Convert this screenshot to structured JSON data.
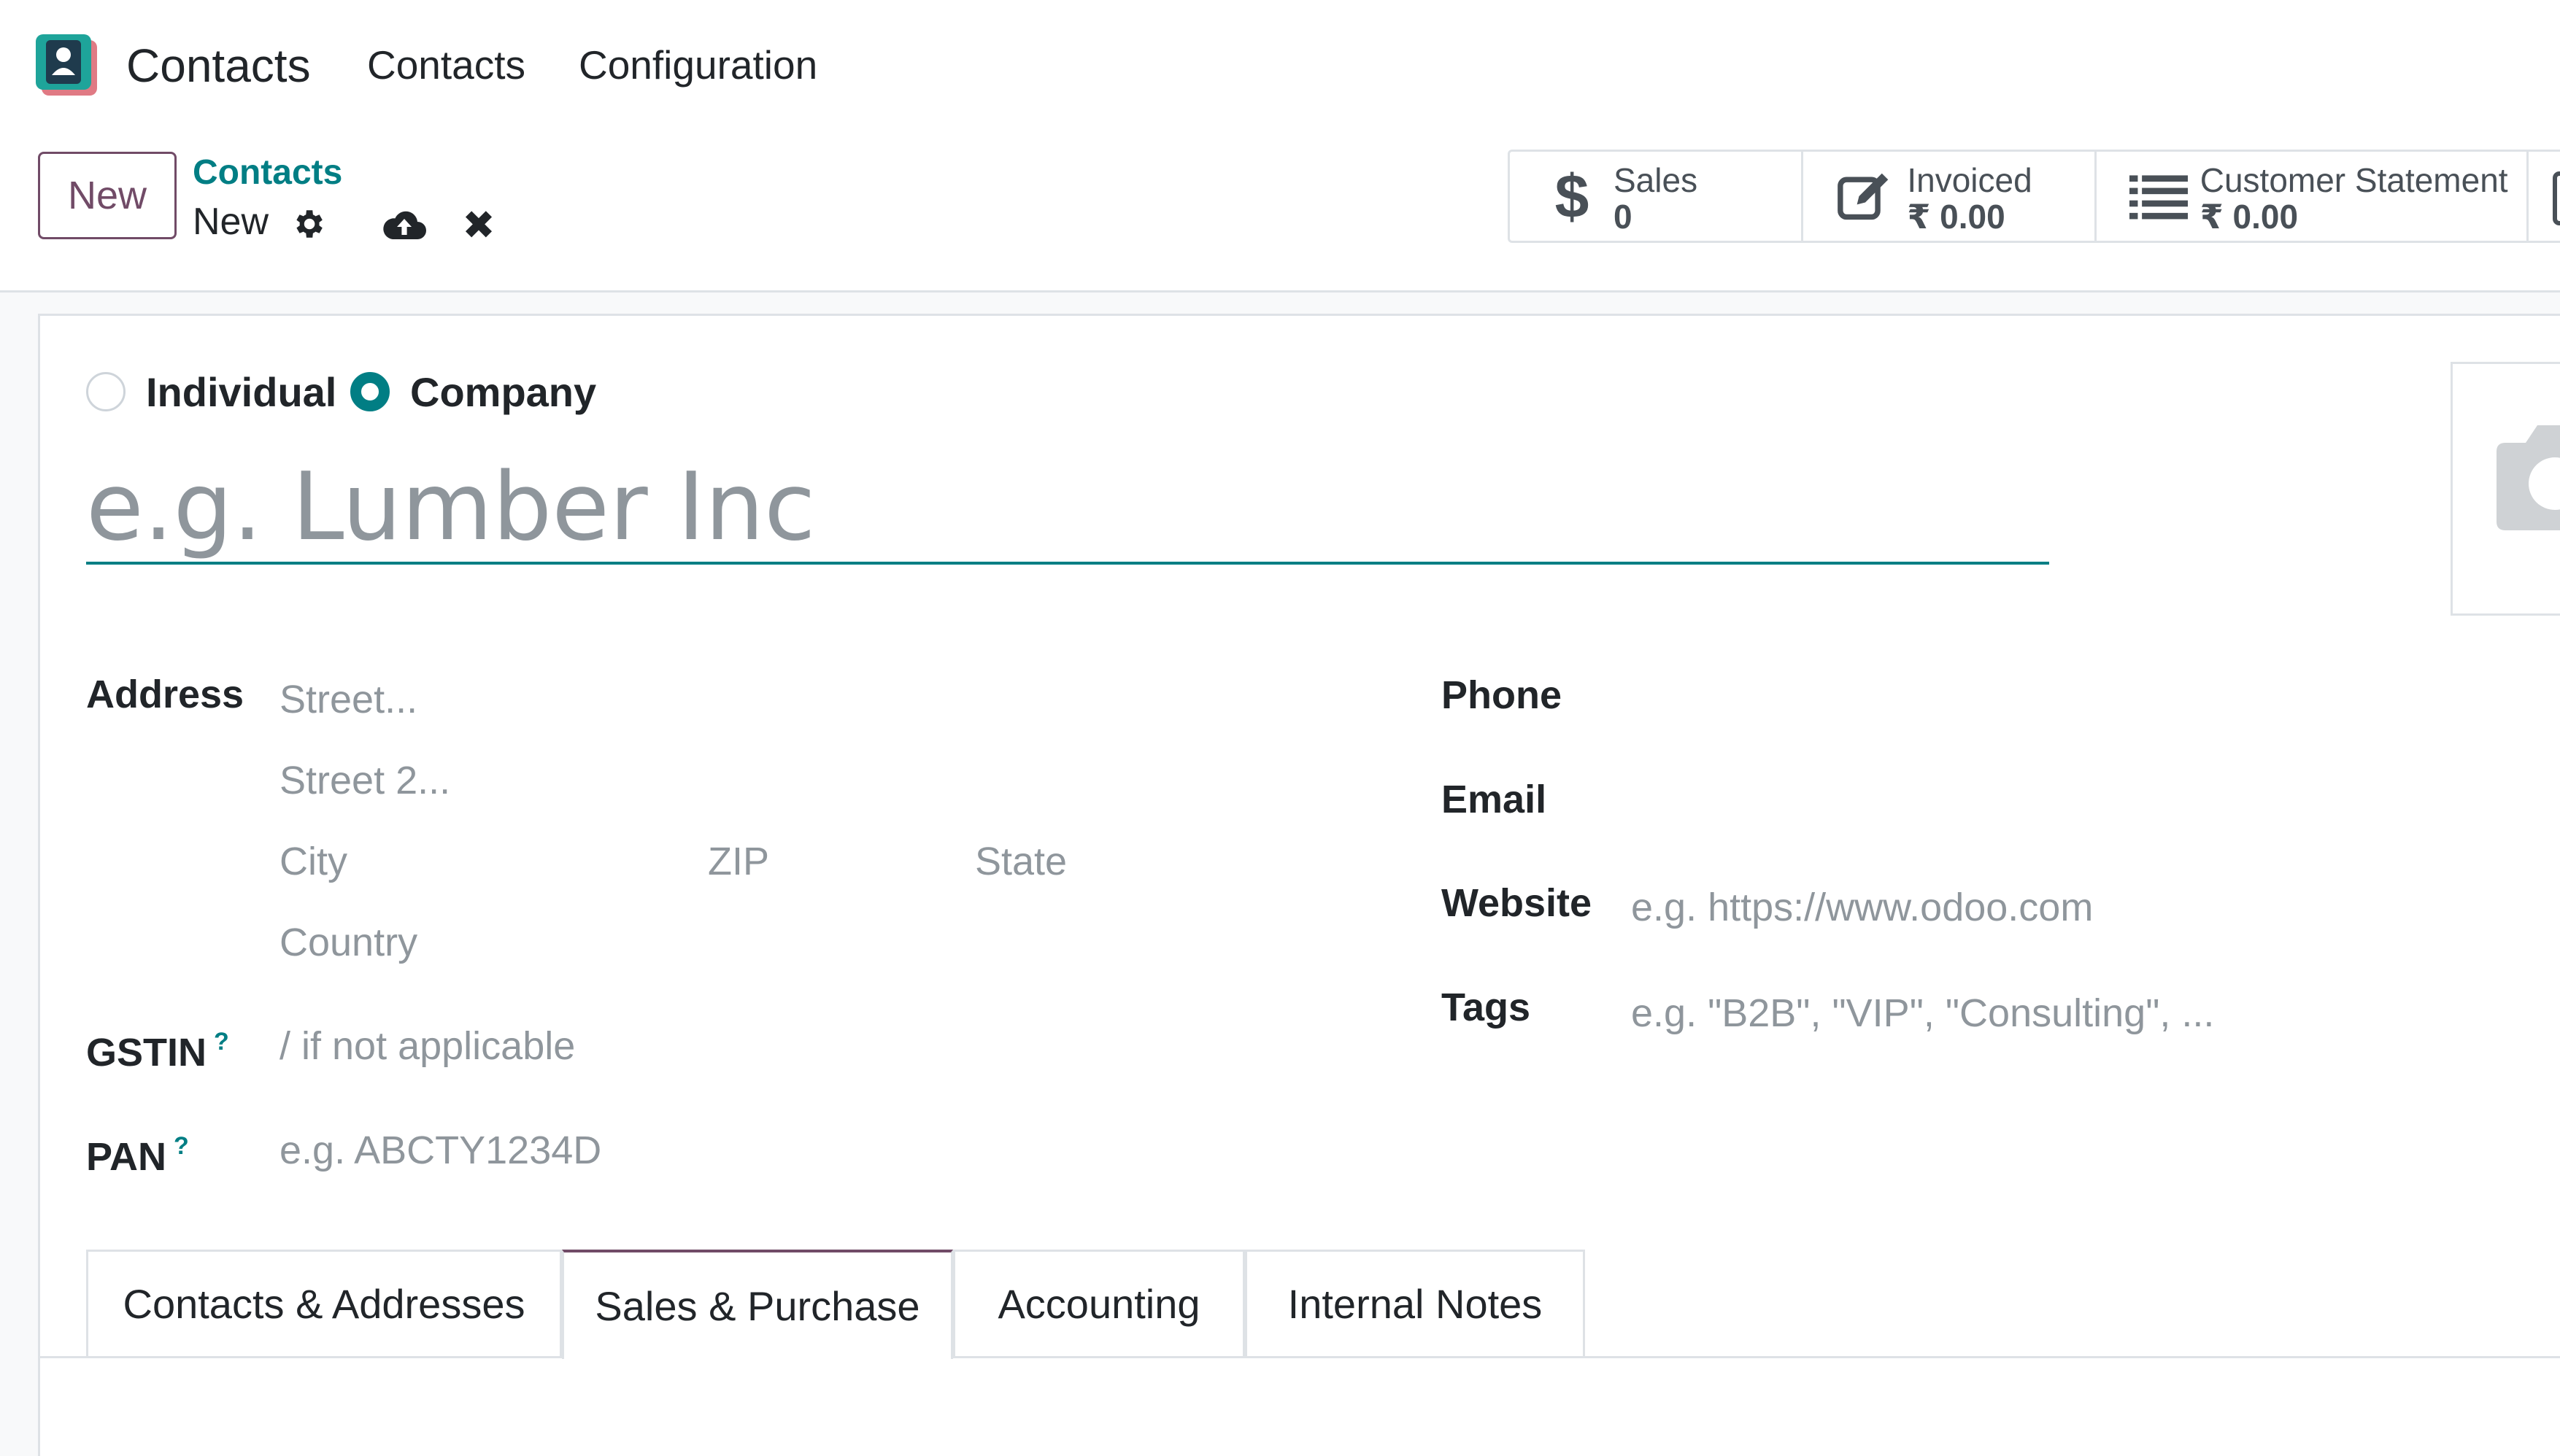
{
  "nav": {
    "app_name": "Contacts",
    "items": [
      "Contacts",
      "Configuration"
    ]
  },
  "control_panel": {
    "new_button": "New",
    "breadcrumb_parent": "Contacts",
    "breadcrumb_current": "New"
  },
  "stats": {
    "sales": {
      "label": "Sales",
      "value": "0"
    },
    "invoiced": {
      "label": "Invoiced",
      "value": "₹ 0.00"
    },
    "statement": {
      "label": "Customer Statement",
      "value": "₹ 0.00"
    }
  },
  "form": {
    "type_options": [
      "Individual",
      "Company"
    ],
    "selected_type": "Company",
    "name_placeholder": "e.g. Lumber Inc",
    "address_label": "Address",
    "street_placeholder": "Street...",
    "street2_placeholder": "Street 2...",
    "city_placeholder": "City",
    "zip_placeholder": "ZIP",
    "state_placeholder": "State",
    "country_placeholder": "Country",
    "gstin_label": "GSTIN",
    "gstin_placeholder": "/ if not applicable",
    "pan_label": "PAN",
    "pan_placeholder": "e.g. ABCTY1234D",
    "help_mark": "?",
    "phone_label": "Phone",
    "email_label": "Email",
    "website_label": "Website",
    "website_placeholder": "e.g. https://www.odoo.com",
    "tags_label": "Tags",
    "tags_placeholder": "e.g. \"B2B\", \"VIP\", \"Consulting\", ..."
  },
  "tabs": [
    "Contacts & Addresses",
    "Sales & Purchase",
    "Accounting",
    "Internal Notes"
  ],
  "active_tab": "Sales & Purchase",
  "colors": {
    "brand": "#714b67",
    "accent": "#017e84",
    "logo_bg": "#1ea49a",
    "logo_shadow": "#e07a84"
  },
  "icons": [
    "contacts-app-logo",
    "gear-icon",
    "cloud-upload-icon",
    "close-icon",
    "dollar-icon",
    "edit-icon",
    "list-icon",
    "camera-icon"
  ]
}
